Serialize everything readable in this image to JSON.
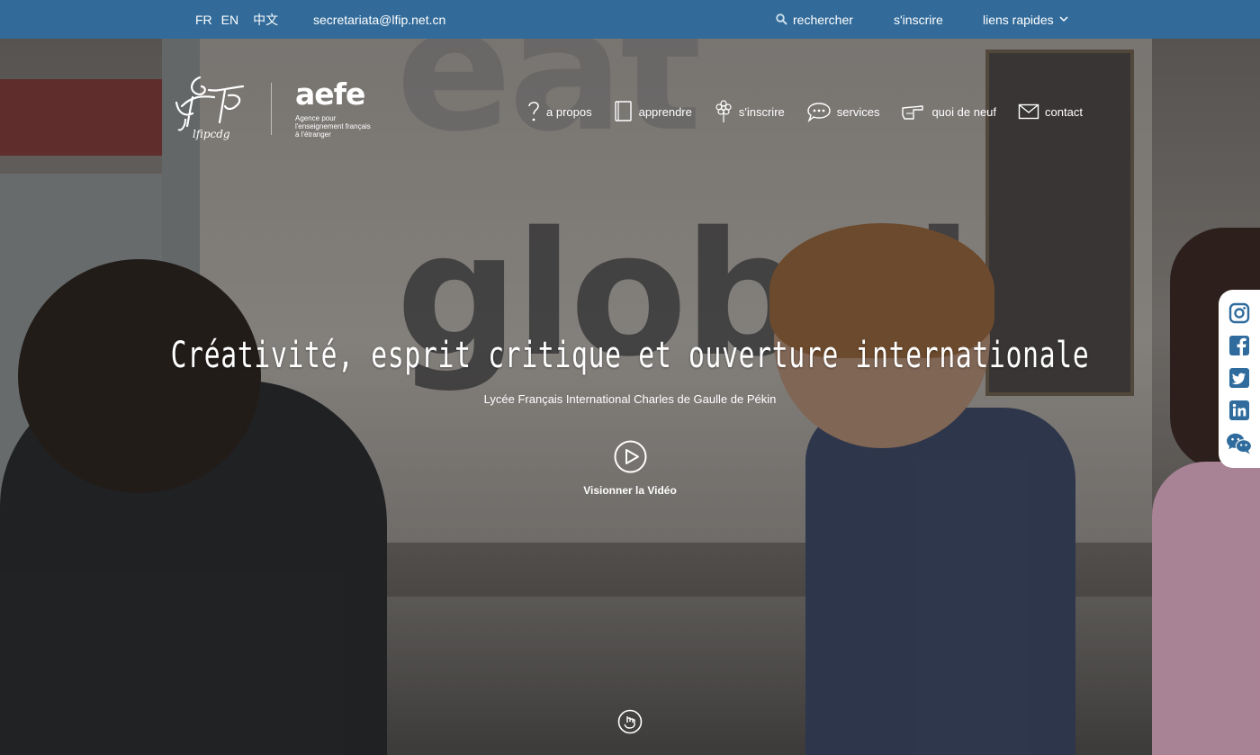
{
  "topbar": {
    "languages": [
      "FR",
      "EN",
      "中文"
    ],
    "email": "secretariata@lfip.net.cn",
    "search_label": "rechercher",
    "register_label": "s'inscrire",
    "quick_links_label": "liens rapides"
  },
  "header": {
    "logo_text": "lfipcdg",
    "partner_name": "aefe",
    "partner_subtitle": "Agence pour l'enseignement français à l'étranger"
  },
  "nav": {
    "items": [
      {
        "label": "a propos",
        "icon": "question-icon"
      },
      {
        "label": "apprendre",
        "icon": "book-icon"
      },
      {
        "label": "s'inscrire",
        "icon": "flower-icon"
      },
      {
        "label": "services",
        "icon": "chat-bubble-icon"
      },
      {
        "label": "quoi de neuf",
        "icon": "pointing-hand-icon"
      },
      {
        "label": "contact",
        "icon": "envelope-icon"
      }
    ]
  },
  "hero": {
    "headline": "Créativité, esprit critique et ouverture internationale",
    "subtitle": "Lycée Français International Charles de Gaulle de Pékin",
    "video_label": "Visionner la Vidéo",
    "background_words": [
      "eat",
      "global"
    ]
  },
  "social": [
    "instagram-icon",
    "facebook-icon",
    "twitter-icon",
    "linkedin-icon",
    "wechat-icon"
  ],
  "colors": {
    "topbar": "#326b9a",
    "social_icon": "#2f6c9d",
    "text": "#ffffff"
  }
}
